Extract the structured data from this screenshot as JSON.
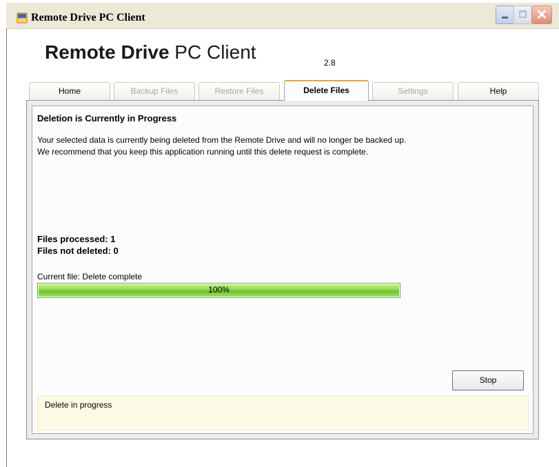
{
  "window": {
    "title": "Remote Drive PC Client",
    "minimize_icon": "minimize-icon",
    "maximize_icon": "maximize-icon",
    "close_icon": "close-icon",
    "close_glyph": "✕"
  },
  "header": {
    "brand_bold": "Remote Drive",
    "brand_light": " PC Client",
    "version": "2.8"
  },
  "tabs": [
    {
      "label": "Home",
      "state": "normal"
    },
    {
      "label": "Backup Files",
      "state": "disabled"
    },
    {
      "label": "Restore Files",
      "state": "disabled"
    },
    {
      "label": "Delete Files",
      "state": "active"
    },
    {
      "label": "Settings",
      "state": "disabled"
    },
    {
      "label": "Help",
      "state": "normal"
    }
  ],
  "main": {
    "heading": "Deletion is Currently in Progress",
    "description_line1": "Your selected data is currently being deleted from the Remote Drive and will no longer be backed up.",
    "description_line2": "We recommend that you keep this application running until this delete request is complete.",
    "files_processed": "Files processed: 1",
    "files_not_deleted": "Files not deleted: 0",
    "current_file": "Current file: Delete complete",
    "progress_label": "100%",
    "progress_fraction": 1.0,
    "stop_label": "Stop"
  },
  "status": {
    "text": "Delete in progress"
  },
  "colors": {
    "progress_green": "#8fd64c",
    "active_tab_accent": "#e7a23a",
    "status_background": "#fbfbe6"
  }
}
